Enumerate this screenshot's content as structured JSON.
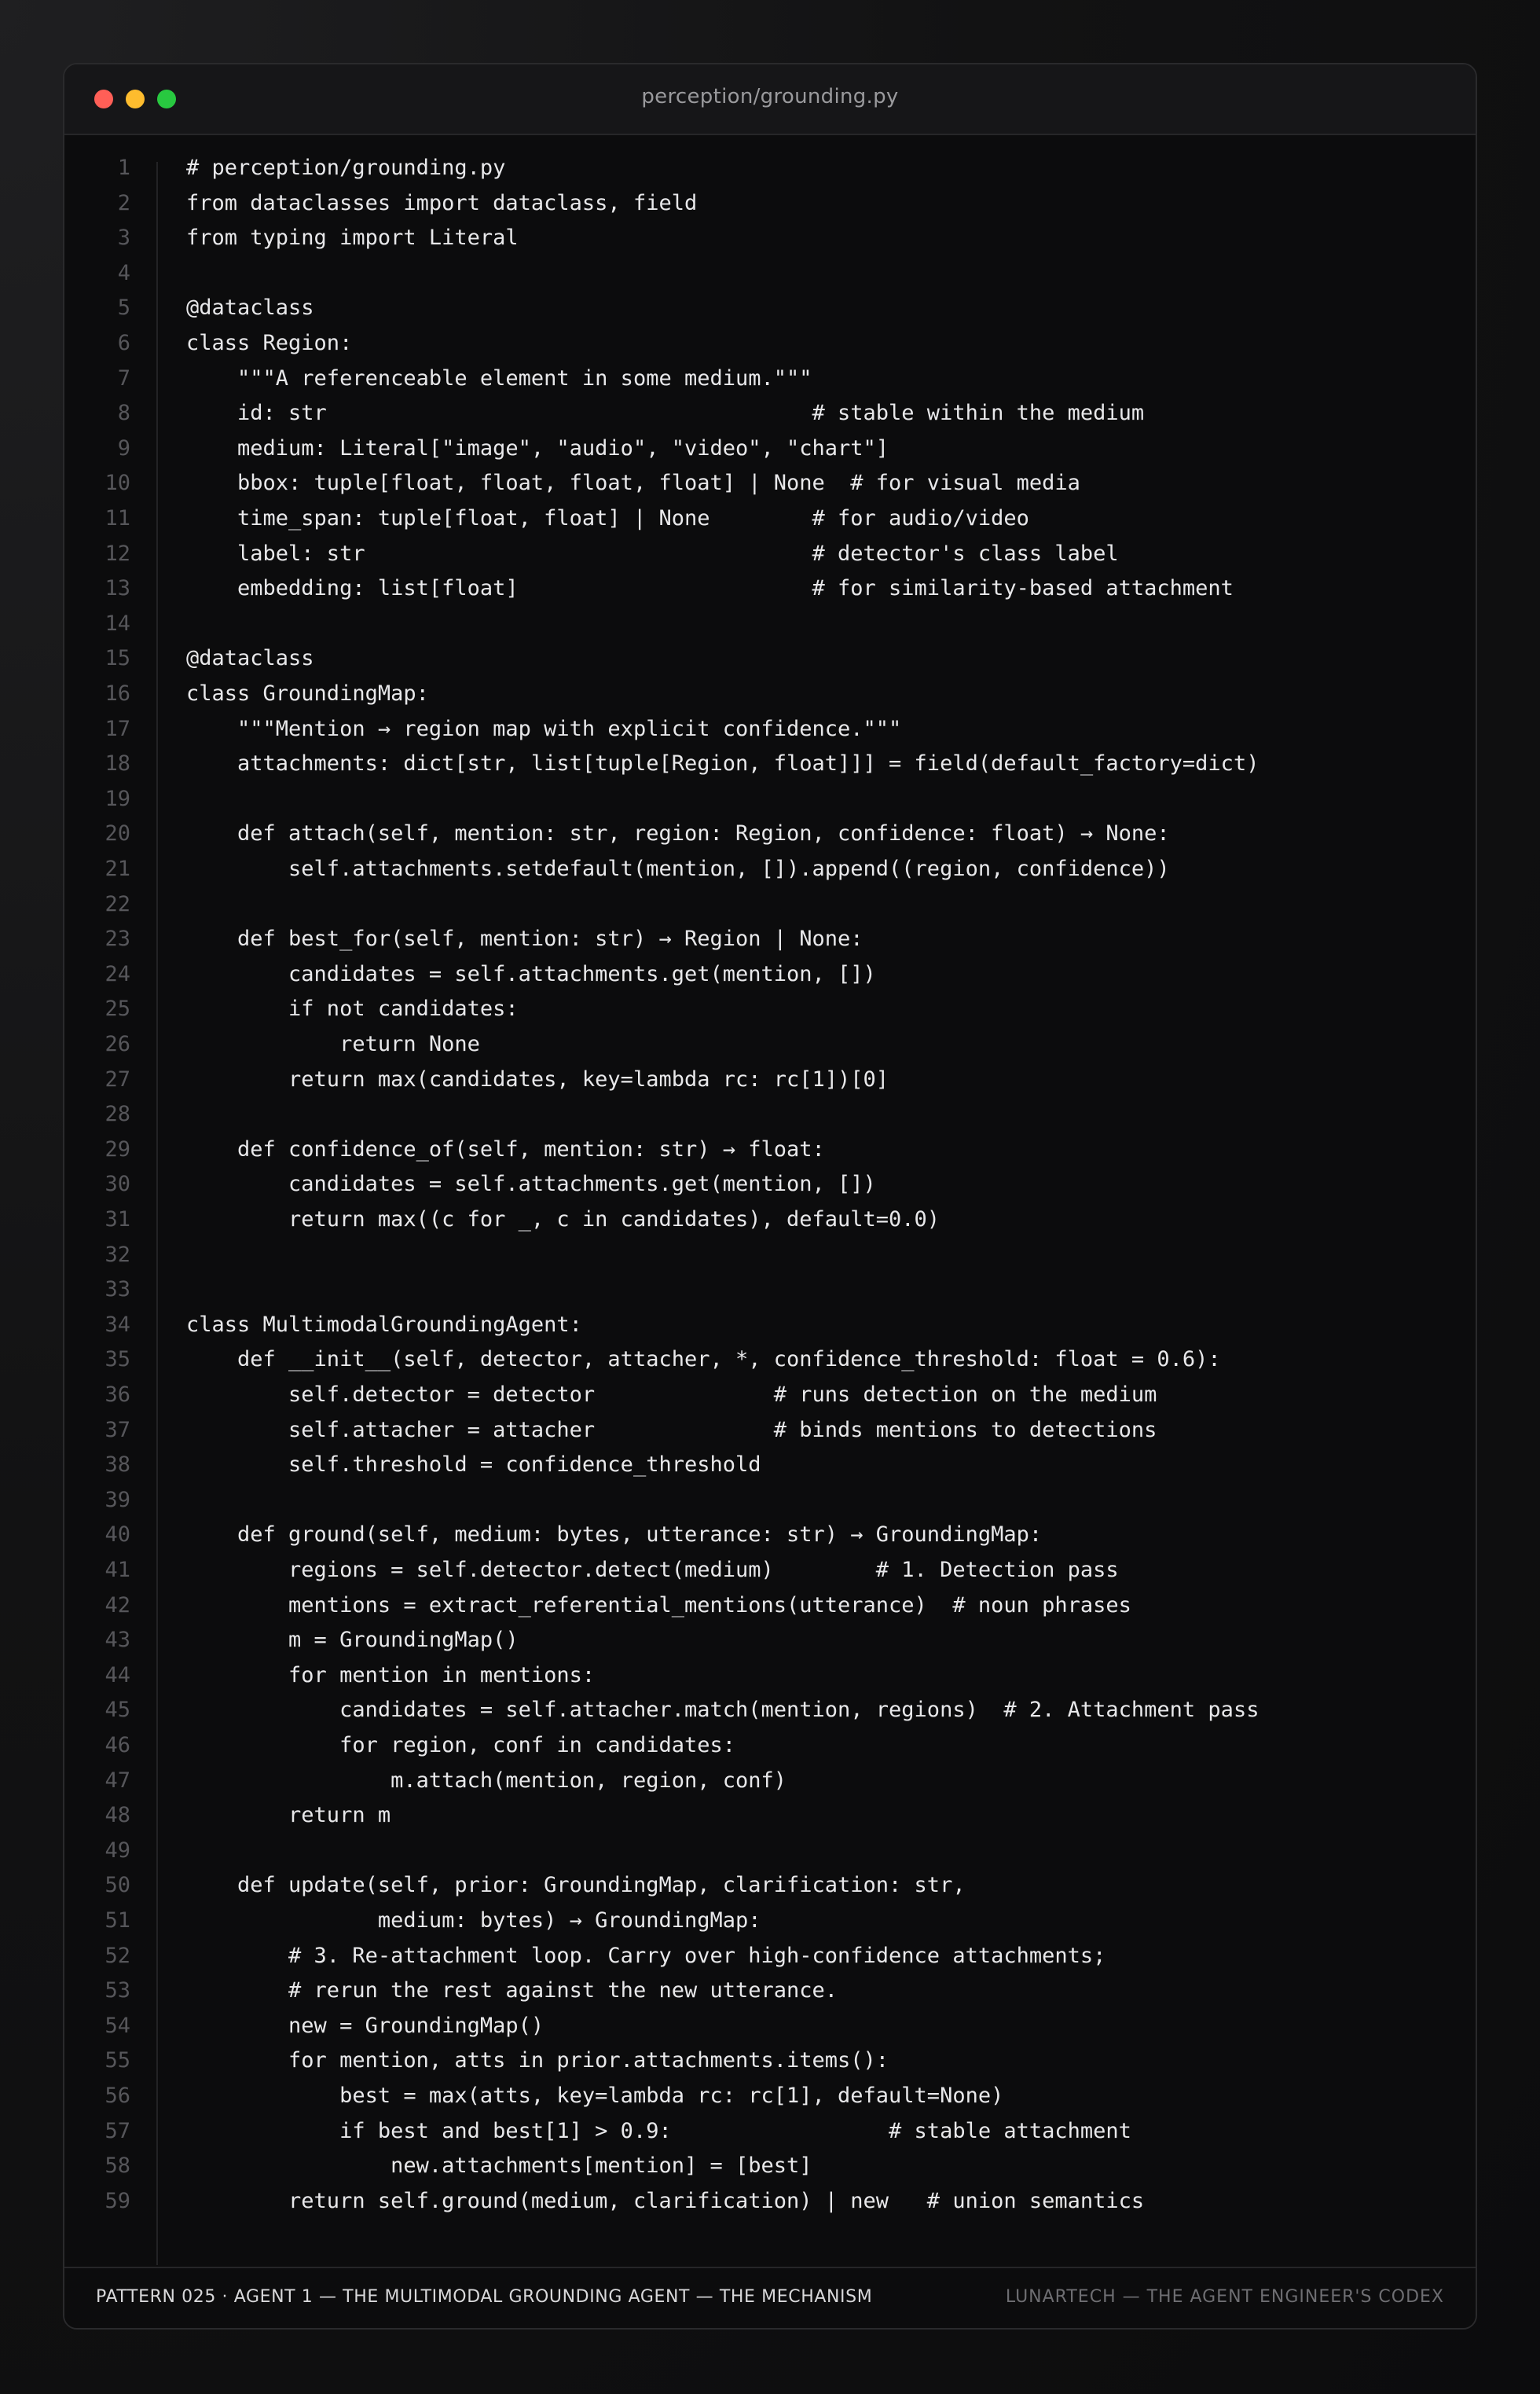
{
  "window": {
    "title": "perception/grounding.py"
  },
  "code_lines": [
    "# perception/grounding.py",
    "from dataclasses import dataclass, field",
    "from typing import Literal",
    "",
    "@dataclass",
    "class Region:",
    "    \"\"\"A referenceable element in some medium.\"\"\"",
    "    id: str                                      # stable within the medium",
    "    medium: Literal[\"image\", \"audio\", \"video\", \"chart\"]",
    "    bbox: tuple[float, float, float, float] | None  # for visual media",
    "    time_span: tuple[float, float] | None        # for audio/video",
    "    label: str                                   # detector's class label",
    "    embedding: list[float]                       # for similarity-based attachment",
    "",
    "@dataclass",
    "class GroundingMap:",
    "    \"\"\"Mention → region map with explicit confidence.\"\"\"",
    "    attachments: dict[str, list[tuple[Region, float]]] = field(default_factory=dict)",
    "",
    "    def attach(self, mention: str, region: Region, confidence: float) → None:",
    "        self.attachments.setdefault(mention, []).append((region, confidence))",
    "",
    "    def best_for(self, mention: str) → Region | None:",
    "        candidates = self.attachments.get(mention, [])",
    "        if not candidates:",
    "            return None",
    "        return max(candidates, key=lambda rc: rc[1])[0]",
    "",
    "    def confidence_of(self, mention: str) → float:",
    "        candidates = self.attachments.get(mention, [])",
    "        return max((c for _, c in candidates), default=0.0)",
    "",
    "",
    "class MultimodalGroundingAgent:",
    "    def __init__(self, detector, attacher, *, confidence_threshold: float = 0.6):",
    "        self.detector = detector              # runs detection on the medium",
    "        self.attacher = attacher              # binds mentions to detections",
    "        self.threshold = confidence_threshold",
    "",
    "    def ground(self, medium: bytes, utterance: str) → GroundingMap:",
    "        regions = self.detector.detect(medium)        # 1. Detection pass",
    "        mentions = extract_referential_mentions(utterance)  # noun phrases",
    "        m = GroundingMap()",
    "        for mention in mentions:",
    "            candidates = self.attacher.match(mention, regions)  # 2. Attachment pass",
    "            for region, conf in candidates:",
    "                m.attach(mention, region, conf)",
    "        return m",
    "",
    "    def update(self, prior: GroundingMap, clarification: str,",
    "               medium: bytes) → GroundingMap:",
    "        # 3. Re-attachment loop. Carry over high-confidence attachments;",
    "        # rerun the rest against the new utterance.",
    "        new = GroundingMap()",
    "        for mention, atts in prior.attachments.items():",
    "            best = max(atts, key=lambda rc: rc[1], default=None)",
    "            if best and best[1] > 0.9:                 # stable attachment",
    "                new.attachments[mention] = [best]",
    "        return self.ground(medium, clarification) | new   # union semantics"
  ],
  "footer": {
    "left": "PATTERN 025 · AGENT 1 — THE MULTIMODAL GROUNDING AGENT — THE MECHANISM",
    "right": "LUNARTECH — THE AGENT ENGINEER'S CODEX"
  },
  "colors": {
    "background": "#0c0c0d",
    "code_text": "#e8e8ea",
    "line_number": "#56565a",
    "traffic_red": "#ff5f57",
    "traffic_yellow": "#febc2e",
    "traffic_green": "#28c840"
  }
}
